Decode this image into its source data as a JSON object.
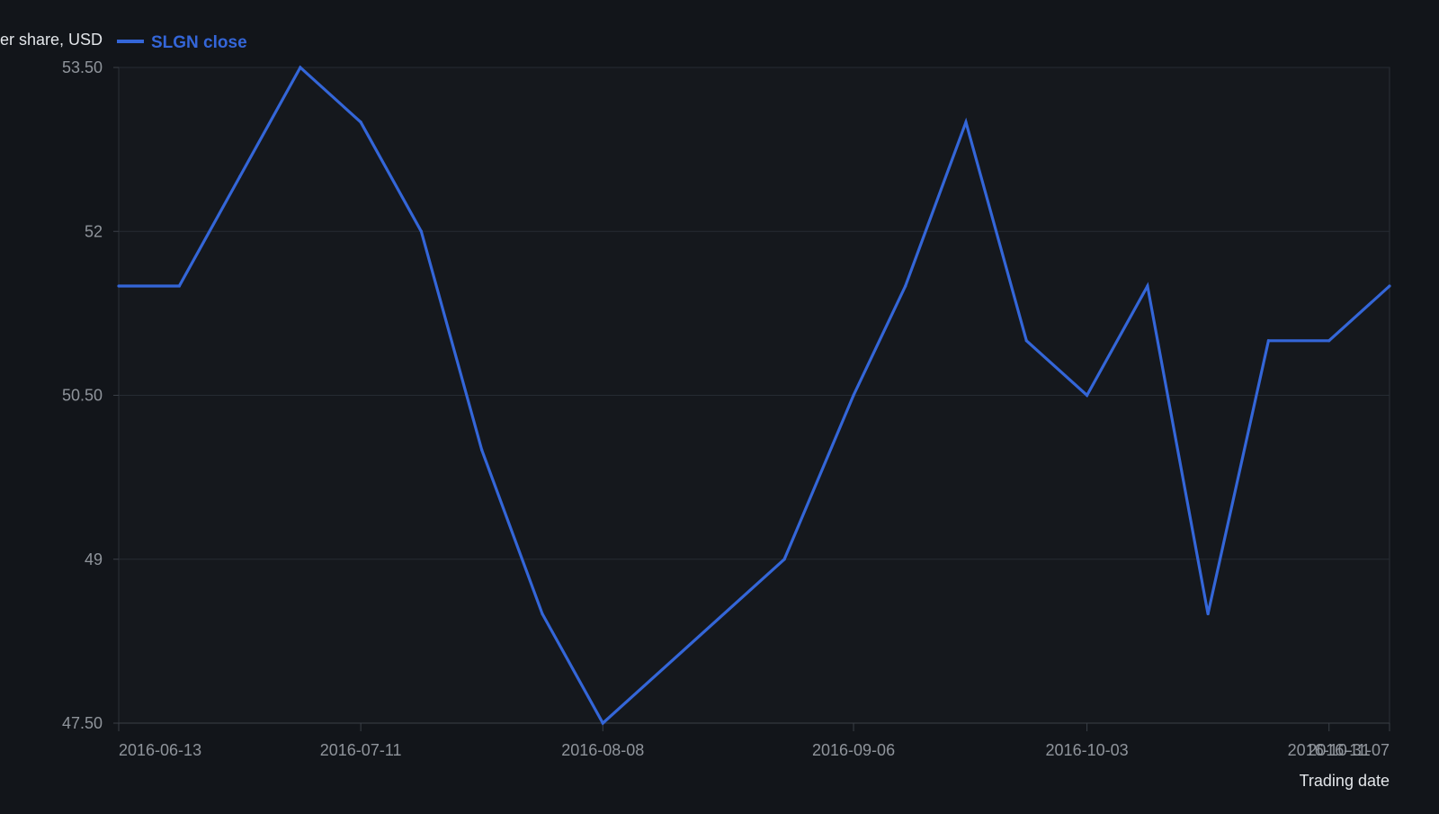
{
  "chart_data": {
    "type": "line",
    "ylabel": "Price per share, USD",
    "xlabel": "Trading date",
    "ylim": [
      47.5,
      53.5
    ],
    "y_ticks": [
      "47.50",
      "49",
      "50.50",
      "52",
      "53.50"
    ],
    "x_ticks": [
      "2016-06-13",
      "2016-07-11",
      "2016-08-08",
      "2016-09-06",
      "2016-10-03",
      "2016-10-31",
      "2016-11-07"
    ],
    "grid": true,
    "legend_position": "top-left",
    "series": [
      {
        "name": "SLGN close",
        "color": "#3466d8",
        "points": [
          {
            "x": "2016-06-13",
            "y": 51.5
          },
          {
            "x": "2016-06-20",
            "y": 51.5
          },
          {
            "x": "2016-06-27",
            "y": 52.5
          },
          {
            "x": "2016-07-04",
            "y": 53.5
          },
          {
            "x": "2016-07-11",
            "y": 53.0
          },
          {
            "x": "2016-07-18",
            "y": 52.0
          },
          {
            "x": "2016-07-25",
            "y": 50.0
          },
          {
            "x": "2016-08-01",
            "y": 48.5
          },
          {
            "x": "2016-08-08",
            "y": 47.5
          },
          {
            "x": "2016-08-29",
            "y": 49.0
          },
          {
            "x": "2016-09-06",
            "y": 50.5
          },
          {
            "x": "2016-09-12",
            "y": 51.5
          },
          {
            "x": "2016-09-19",
            "y": 53.0
          },
          {
            "x": "2016-09-26",
            "y": 51.0
          },
          {
            "x": "2016-10-03",
            "y": 50.5
          },
          {
            "x": "2016-10-10",
            "y": 51.5
          },
          {
            "x": "2016-10-17",
            "y": 48.5
          },
          {
            "x": "2016-10-24",
            "y": 51.0
          },
          {
            "x": "2016-10-31",
            "y": 51.0
          },
          {
            "x": "2016-11-07",
            "y": 51.5
          }
        ]
      }
    ]
  }
}
